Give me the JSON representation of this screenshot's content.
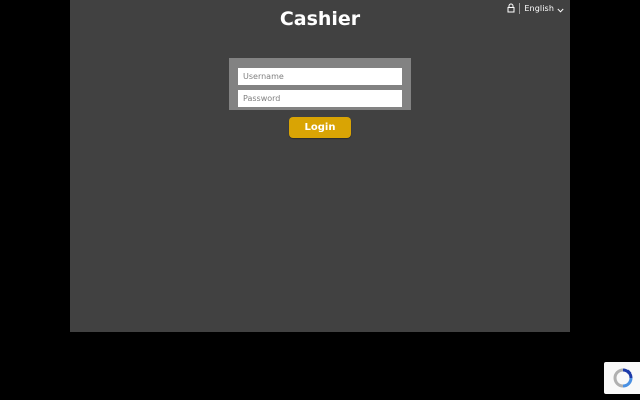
{
  "header": {
    "title": "Cashier",
    "language": "English",
    "lock_icon": "lock-icon",
    "chevron_icon": "chevron-down-icon"
  },
  "login_form": {
    "username_placeholder": "Username",
    "password_placeholder": "Password",
    "login_label": "Login"
  },
  "recaptcha": {
    "icon": "recaptcha-icon"
  },
  "colors": {
    "page_background": "#000000",
    "panel_background": "#414141",
    "form_background": "#828282",
    "login_button": "#d9a404",
    "text": "#ffffff"
  }
}
